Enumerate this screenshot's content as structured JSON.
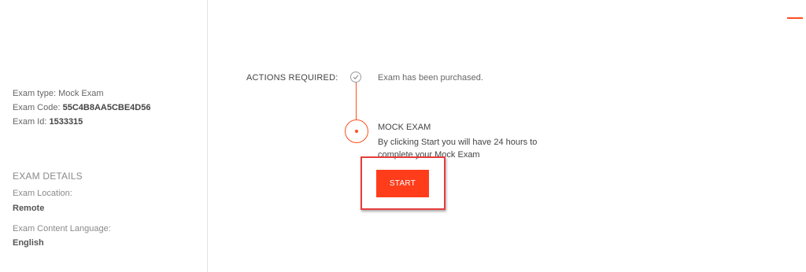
{
  "sidebar": {
    "exam_type_label": "Exam type:",
    "exam_type_value": "Mock Exam",
    "exam_code_label": "Exam Code:",
    "exam_code_value": "55C4B8AA5CBE4D56",
    "exam_id_label": "Exam Id:",
    "exam_id_value": "1533315",
    "details_heading": "EXAM DETAILS",
    "location_label": "Exam Location:",
    "location_value": "Remote",
    "language_label": "Exam Content Language:",
    "language_value": "English"
  },
  "main": {
    "actions_label": "ACTIONS REQUIRED:",
    "steps": [
      {
        "text": "Exam has been purchased.",
        "status": "completed",
        "icon": "check-icon"
      },
      {
        "title": "MOCK EXAM",
        "description": "By clicking Start you will have 24 hours to complete your Mock Exam",
        "status": "current",
        "icon": "dot-icon"
      }
    ],
    "start_button_label": "START"
  },
  "colors": {
    "accent": "#ff4f1f",
    "button": "#ff3d1b",
    "highlight_border": "#e83c3c",
    "divider": "#e3e3e3"
  }
}
